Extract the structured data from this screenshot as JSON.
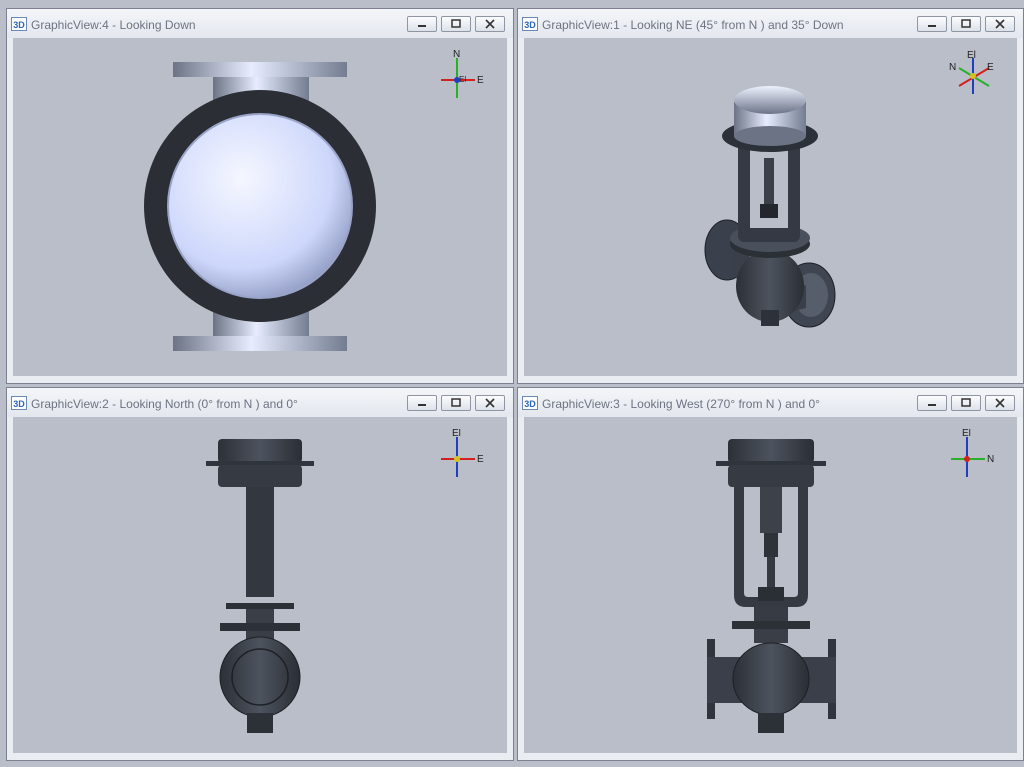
{
  "views": [
    {
      "title": "GraphicView:4 - Looking Down",
      "badge": "3D",
      "axis": {
        "up": "N",
        "right": "E",
        "extra": "El"
      }
    },
    {
      "title": "GraphicView:1 - Looking NE (45° from N ) and 35° Down",
      "badge": "3D",
      "axis": {
        "up": "El",
        "left": "N",
        "right": "E"
      }
    },
    {
      "title": "GraphicView:2 - Looking North (0° from N ) and 0°",
      "badge": "3D",
      "axis": {
        "up": "El",
        "right": "E"
      }
    },
    {
      "title": "GraphicView:3 - Looking West (270° from N ) and 0°",
      "badge": "3D",
      "axis": {
        "up": "El",
        "right": "N"
      }
    }
  ],
  "colors": {
    "viewport": "#b9bec9",
    "metal": "#3d424b",
    "highlight": "#d7dff8"
  }
}
